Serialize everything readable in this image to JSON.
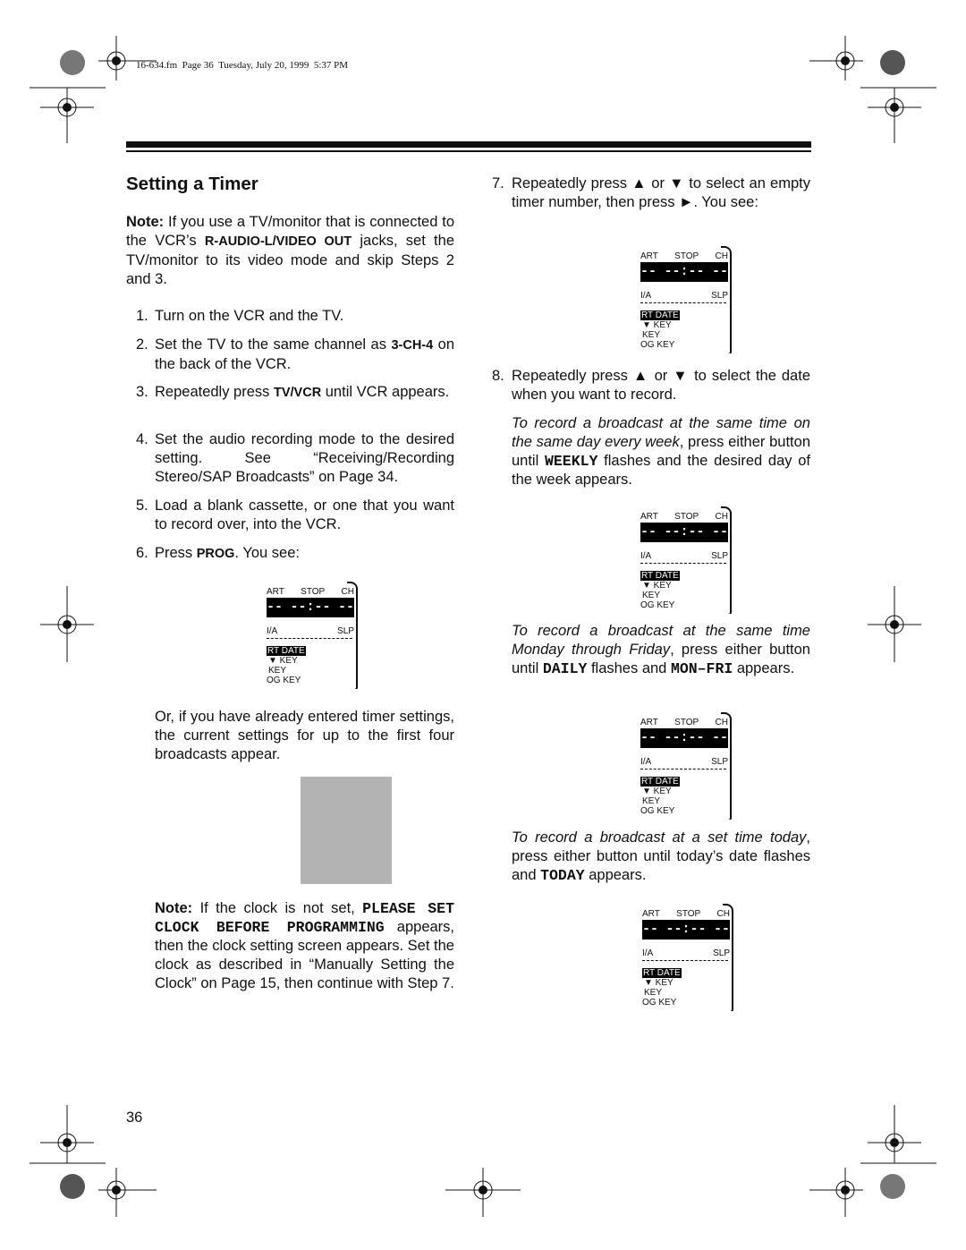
{
  "header": {
    "file_info": "16-634.fm  Page 36  Tuesday, July 20, 1999  5:37 PM"
  },
  "title": "Setting a Timer",
  "left": {
    "note1": {
      "label": "Note:",
      "t1": " If you use a TV/monitor that is connected to the VCR’s ",
      "b1": "R-AUDIO-L/VIDEO OUT",
      "t2": " jacks, set the TV/monitor to its video mode and skip Steps 2 and 3."
    },
    "steps": [
      {
        "n": "1.",
        "t": "Turn on the VCR and the TV."
      },
      {
        "n": "2.",
        "t": "Set the TV to the same channel as ",
        "b": "3-CH-4",
        "t2": " on the back of the VCR."
      },
      {
        "n": "3.",
        "t": "Repeatedly press ",
        "b": "TV/VCR",
        "t2": " until VCR appears."
      },
      {
        "n": "4.",
        "t": "Set the audio recording mode to the desired setting. See “Receiving/Recording Stereo/SAP Broadcasts” on Page 34."
      },
      {
        "n": "5.",
        "t": "Load a blank cassette, or one that you want to record over, into the VCR."
      },
      {
        "n": "6.",
        "t": "Press ",
        "b": "PROG",
        "t2": ". You see:"
      }
    ],
    "or_text": "Or, if you have already entered timer settings, the current settings for up to the first four broadcasts appear.",
    "note2": {
      "label": "Note:",
      "t1": " If the clock is not set, ",
      "m1": "PLEASE SET CLOCK BEFORE PROGRAMMING",
      "t2": " appears, then the clock setting screen appears. Set the clock as described in “Manually Setting the Clock” on Page 15, then continue with Step 7."
    }
  },
  "right": {
    "step7": {
      "n": "7.",
      "t1": "Repeatedly press ",
      "up": "▲",
      "t2": " or ",
      "down": "▼",
      "t3": " to select an empty timer number, then press ",
      "right": "►",
      "t4": ". You see:"
    },
    "step8": {
      "n": "8.",
      "t1": "Repeatedly press ",
      "up": "▲",
      "t2": " or ",
      "down": "▼",
      "t3": " to select the date when you want to record."
    },
    "weekly": {
      "i": "To record a broadcast at the same time on the same day every week",
      "t1": ", press either button until ",
      "m": "WEEKLY",
      "t2": " flashes and the desired day of the week appears."
    },
    "daily": {
      "i": "To record a broadcast at the same time Monday through Friday",
      "t1": ", press either button until ",
      "m1": "DAILY",
      "t2": " flashes and ",
      "m2": "MON–FRI",
      "t3": " appears."
    },
    "today": {
      "i": "To record a broadcast at a set time today",
      "t1": ", press either button until today’s date flashes and ",
      "m": "TODAY",
      "t2": " appears."
    }
  },
  "display": {
    "start": "ART",
    "stop": "STOP",
    "ch": "CH",
    "seg1": "--",
    "seg2": "--:--",
    "seg3": "--",
    "ia": "I/A",
    "slp": "SLP",
    "start_date": "RT DATE",
    "key1": "▼ KEY",
    "key2": "KEY",
    "key3": "OG KEY"
  },
  "page_number": "36"
}
